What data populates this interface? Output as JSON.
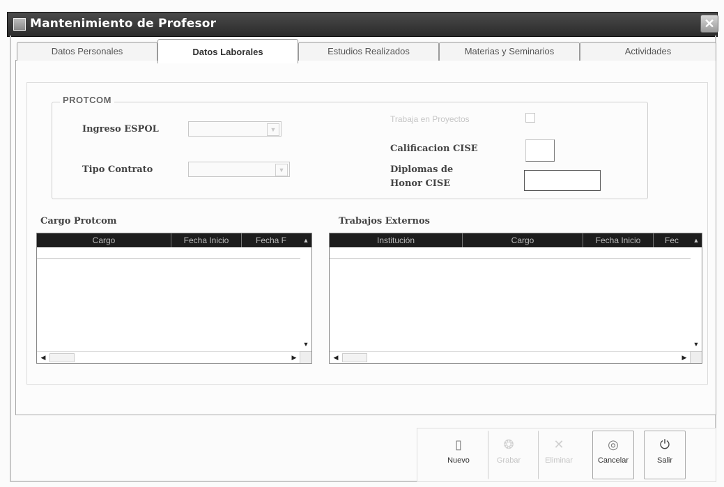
{
  "window": {
    "title": "Mantenimiento de Profesor",
    "close_glyph": "✕"
  },
  "tabs": [
    {
      "label": "Datos Personales",
      "active": false
    },
    {
      "label": "Datos Laborales",
      "active": true
    },
    {
      "label": "Estudios Realizados",
      "active": false
    },
    {
      "label": "Materias y Seminarios",
      "active": false
    },
    {
      "label": "Actividades",
      "active": false
    }
  ],
  "protcom": {
    "legend": "PROTCOM",
    "ingreso_label": "Ingreso ESPOL",
    "ingreso_value": "",
    "tipo_contrato_label": "Tipo Contrato",
    "tipo_contrato_value": "",
    "trabaja_label": "Trabaja en Proyectos",
    "calificacion_label": "Calificacion CISE",
    "calificacion_value": "",
    "diplomas_label_1": "Diplomas de",
    "diplomas_label_2": "Honor CISE",
    "diplomas_value": ""
  },
  "cargo_protcom": {
    "title": "Cargo Protcom",
    "columns": [
      "Cargo",
      "Fecha Inicio",
      "Fecha F"
    ]
  },
  "trabajos_externos": {
    "title": "Trabajos Externos",
    "columns": [
      "Institución",
      "Cargo",
      "Fecha Inicio",
      "Fec"
    ]
  },
  "toolbar": {
    "buttons": [
      {
        "label": "Nuevo",
        "icon": "new-document-icon",
        "glyph": "▯",
        "enabled": true
      },
      {
        "label": "Grabar",
        "icon": "save-icon",
        "glyph": "❂",
        "enabled": false
      },
      {
        "label": "Eliminar",
        "icon": "delete-icon",
        "glyph": "✕",
        "enabled": false
      },
      {
        "label": "Cancelar",
        "icon": "cancel-icon",
        "glyph": "◎",
        "enabled": true
      },
      {
        "label": "Salir",
        "icon": "exit-icon",
        "glyph": "⏻",
        "enabled": true
      }
    ]
  }
}
